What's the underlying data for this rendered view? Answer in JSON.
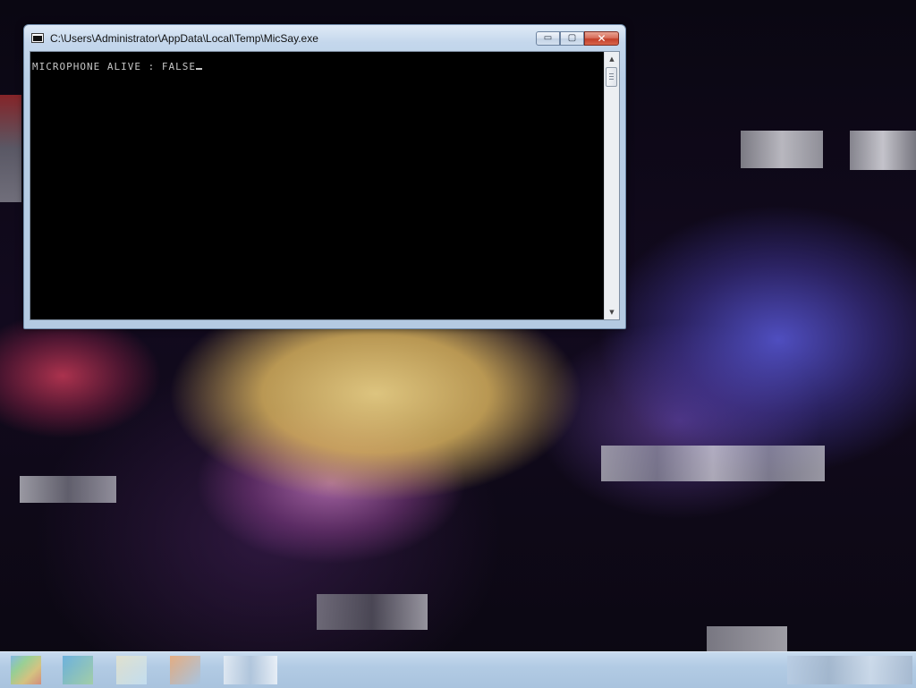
{
  "window": {
    "title": "C:\\Users\\Administrator\\AppData\\Local\\Temp\\MicSay.exe",
    "controls": {
      "minimize_icon": "minimize-icon",
      "maximize_icon": "maximize-icon",
      "close_icon": "close-icon",
      "minimize_glyph": "▭",
      "maximize_glyph": "▢",
      "close_glyph": "✕"
    }
  },
  "console": {
    "output": "MICROPHONE ALIVE : FALSE",
    "text_color": "#c6c6c6",
    "background_color": "#000000"
  },
  "scrollbar": {
    "up_glyph": "▲",
    "down_glyph": "▼"
  },
  "taskbar": {
    "icons": [
      "windows-start-icon",
      "app-icon",
      "app-icon",
      "app-icon",
      "app-icon"
    ]
  },
  "colors": {
    "close_button": "#c3402a",
    "titlebar": "#c4d7ec",
    "taskbar": "#b2cbe4"
  }
}
